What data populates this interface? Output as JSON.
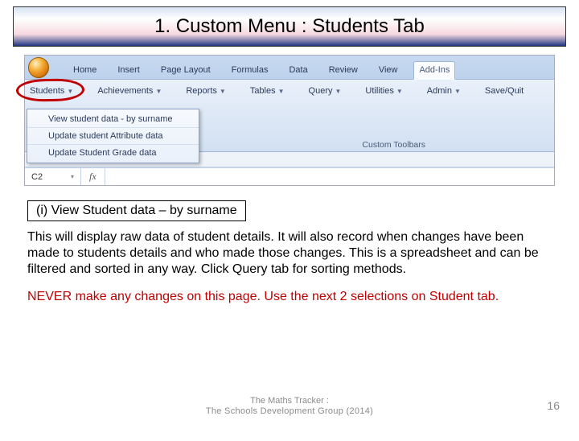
{
  "title": "1.  Custom Menu :  Students Tab",
  "ribbon_tabs": [
    "Home",
    "Insert",
    "Page Layout",
    "Formulas",
    "Data",
    "Review",
    "View",
    "Add-Ins"
  ],
  "active_tab_index": 7,
  "toolbar_buttons": [
    "Students",
    "Achievements",
    "Reports",
    "Tables",
    "Query",
    "Utilities",
    "Admin",
    "Save/Quit"
  ],
  "highlight_button_index": 0,
  "dropdown_items": [
    "View student data - by surname",
    "Update student Attribute data",
    "Update Student Grade data"
  ],
  "group_label": "Custom Toolbars",
  "qat": "⟲ ↷ ⟲ ▾",
  "name_box": "C2",
  "fx_label": "fx",
  "subheading": "(i) View Student data – by surname",
  "paragraph1": "This will display raw data of student details.  It will also record when changes have been made to students details and who made those changes.  This is a spreadsheet and can be filtered and sorted in any way.  Click Query tab for sorting methods.",
  "paragraph2": "NEVER make any changes on this page.  Use the next 2 selections on Student tab.",
  "footer_line1": "The Maths Tracker :",
  "footer_line2": "The Schools Development Group  (2014)",
  "page_number": "16"
}
